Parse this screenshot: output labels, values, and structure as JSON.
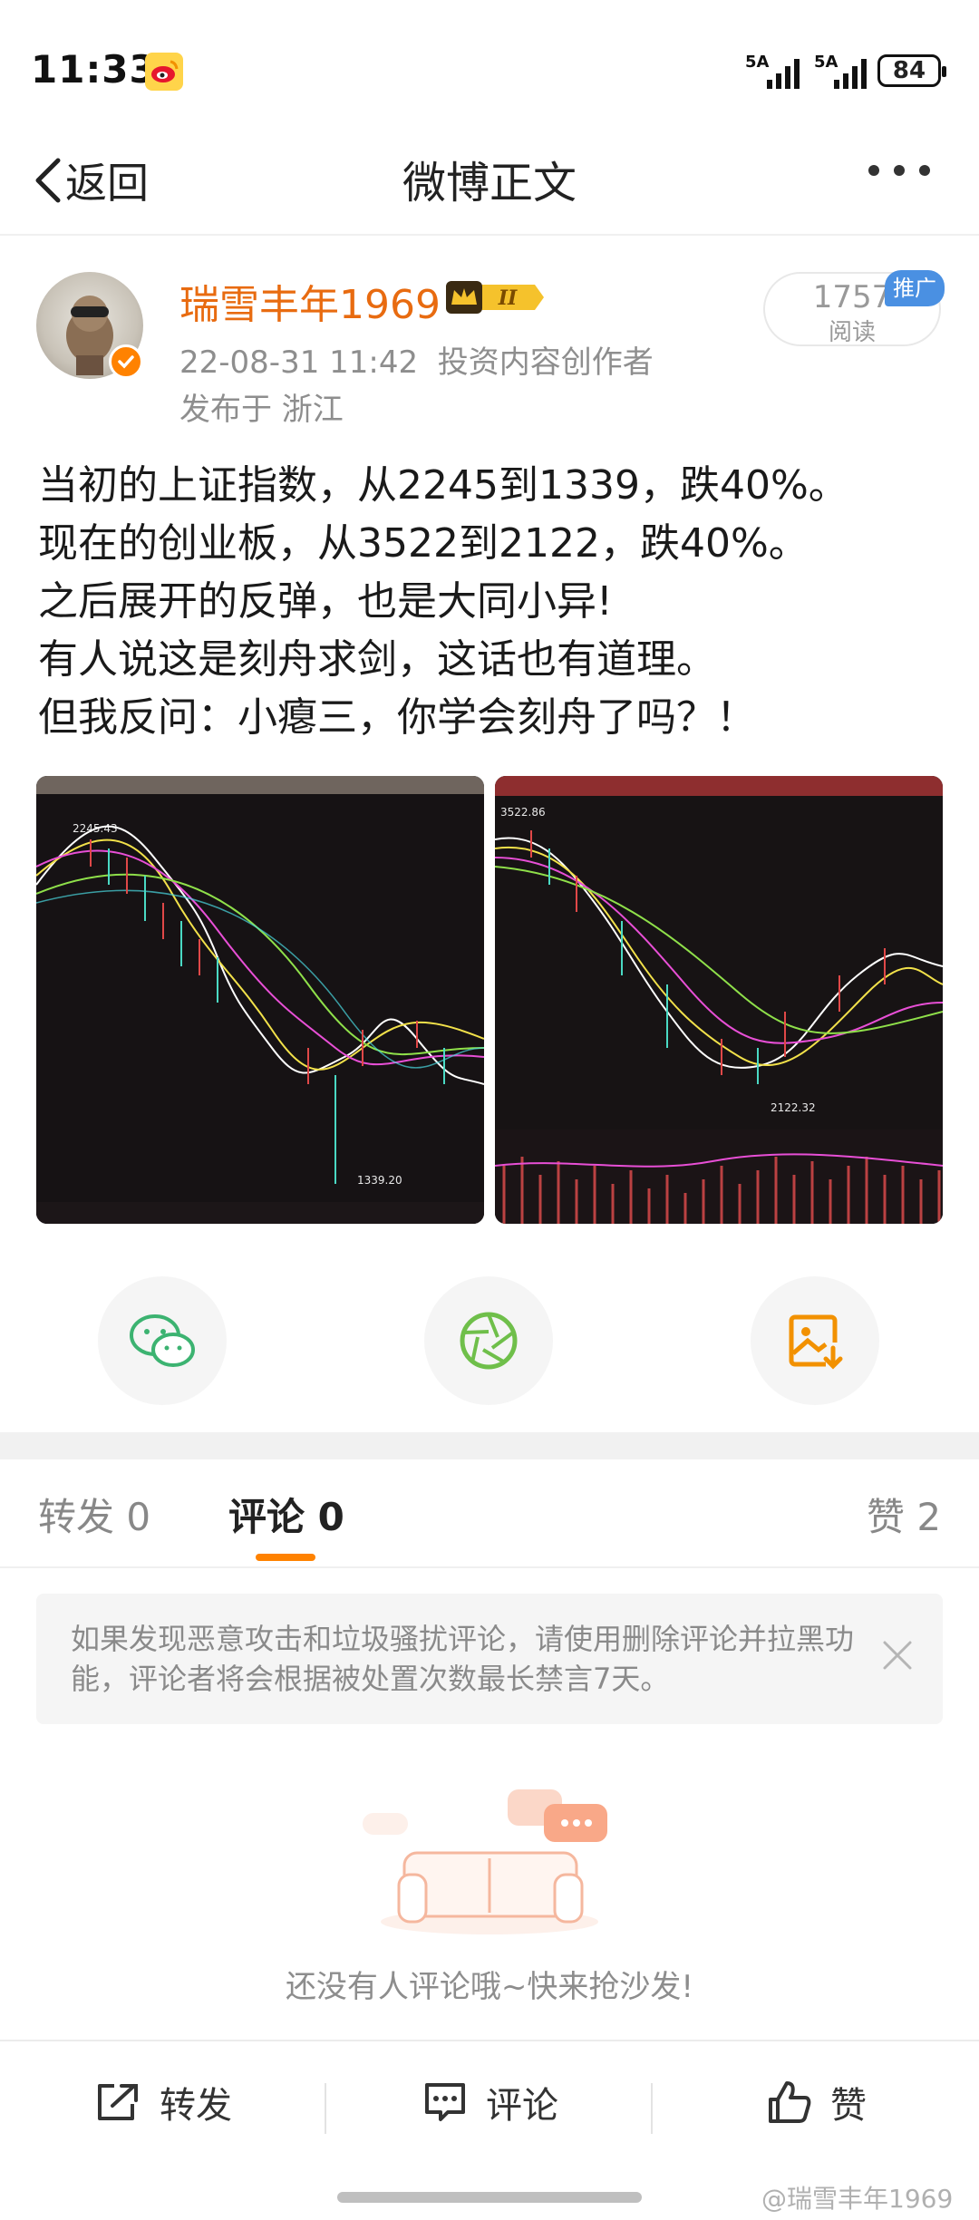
{
  "status_bar": {
    "time": "11:33",
    "signal_1": "5A",
    "signal_2": "5A",
    "battery": "84"
  },
  "nav": {
    "back_label": "返回",
    "title": "微博正文"
  },
  "post": {
    "author_name": "瑞雪丰年1969",
    "date_time": "22-08-31 11:42",
    "author_tag": "投资内容创作者",
    "location": "发布于 浙江",
    "read_count": "1757",
    "read_label": "阅读",
    "promo_tag": "推广",
    "lines": [
      "当初的上证指数，从2245到1339，跌40%。",
      "现在的创业板，从3522到2122，跌40%。",
      "之后展开的反弹，也是大同小异!",
      "有人说这是刻舟求剑，这话也有道理。",
      "但我反问：小瘪三，你学会刻舟了吗？！"
    ],
    "images": [
      {
        "low_label": "1339.20",
        "high_label": "2245.43"
      },
      {
        "low_label": "2122.32",
        "high_label": "3522.86"
      }
    ]
  },
  "tabs": {
    "repost": "转发 0",
    "comment": "评论 0",
    "like": "赞 2"
  },
  "notice": {
    "text": "如果发现恶意攻击和垃圾骚扰评论，请使用删除评论并拉黑功能，评论者将会根据被处置次数最长禁言7天。"
  },
  "empty_state": {
    "text": "还没有人评论哦~快来抢沙发!"
  },
  "actions": {
    "repost": "转发",
    "comment": "评论",
    "like": "赞"
  },
  "watermark": "@瑞雪丰年1969",
  "colors": {
    "accent": "#ff8200",
    "author": "#e86b10",
    "wechat": "#3cb371",
    "moments": "#6fbf4a"
  }
}
